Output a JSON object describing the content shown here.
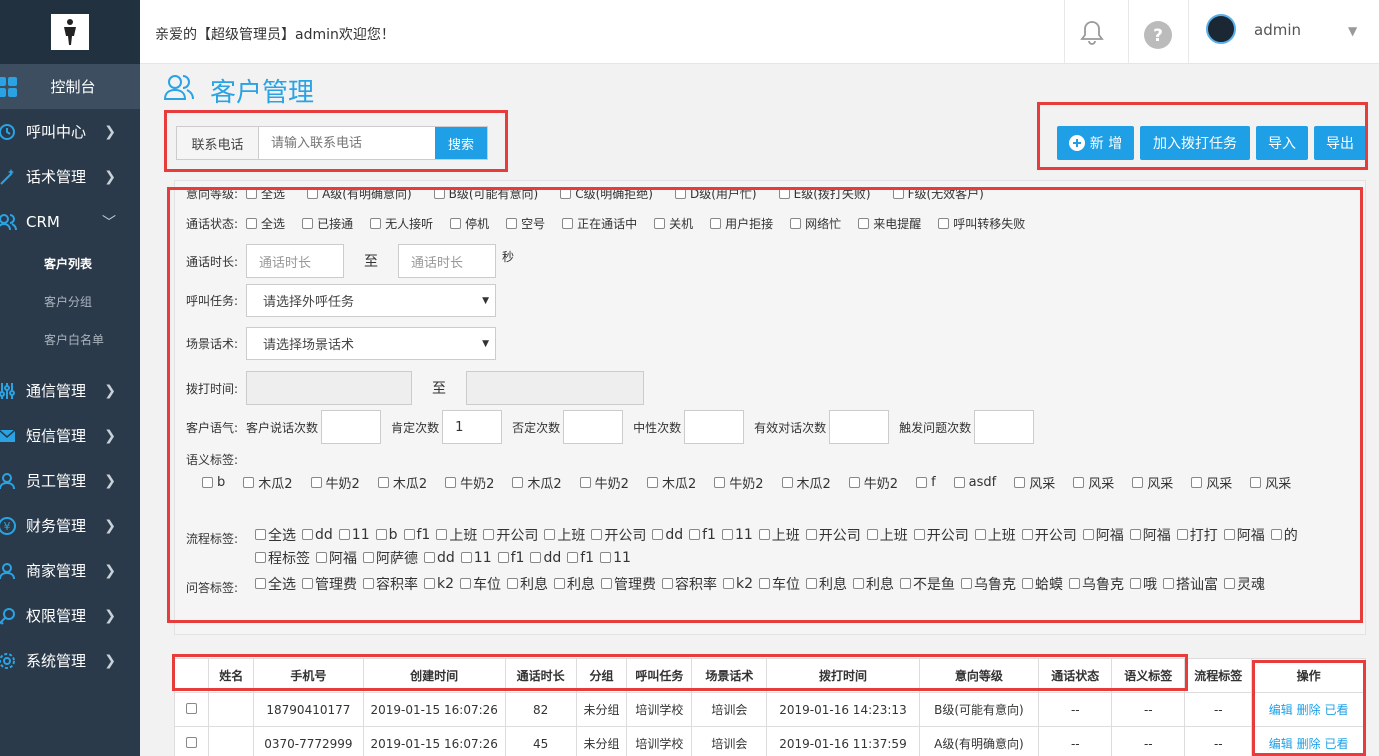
{
  "sidebar": {
    "items": [
      {
        "label": "控制台",
        "icon": "dashboard-icon"
      },
      {
        "label": "呼叫中心",
        "icon": "clock-icon"
      },
      {
        "label": "话术管理",
        "icon": "magic-icon"
      },
      {
        "label": "CRM",
        "icon": "users-icon"
      },
      {
        "label": "通信管理",
        "icon": "sliders-icon"
      },
      {
        "label": "短信管理",
        "icon": "mail-icon"
      },
      {
        "label": "员工管理",
        "icon": "user-icon"
      },
      {
        "label": "财务管理",
        "icon": "yen-icon"
      },
      {
        "label": "商家管理",
        "icon": "user-icon"
      },
      {
        "label": "权限管理",
        "icon": "key-icon"
      },
      {
        "label": "系统管理",
        "icon": "gear-icon"
      }
    ],
    "crm_sub": [
      "客户列表",
      "客户分组",
      "客户白名单"
    ]
  },
  "header": {
    "welcome": "亲爱的【超级管理员】admin欢迎您！",
    "username": "admin"
  },
  "page": {
    "title": "客户管理"
  },
  "search": {
    "label": "联系电话",
    "placeholder": "请输入联系电话",
    "button": "搜索"
  },
  "toolbar": {
    "add": "新 增",
    "add_task": "加入拨打任务",
    "import": "导入",
    "export": "导出"
  },
  "filters": {
    "intent_label": "意向等级:",
    "intent_options": [
      "全选",
      "A级(有明确意向)",
      "B级(可能有意向)",
      "C级(明确拒绝)",
      "D级(用户忙)",
      "E级(拨打失败)",
      "F级(无效客户)"
    ],
    "call_status_label": "通话状态:",
    "call_status_options": [
      "全选",
      "已接通",
      "无人接听",
      "停机",
      "空号",
      "正在通话中",
      "关机",
      "用户拒接",
      "网络忙",
      "来电提醒",
      "呼叫转移失败"
    ],
    "duration_label": "通话时长:",
    "duration_placeholder": "通话时长",
    "to": "至",
    "seconds": "秒",
    "task_label": "呼叫任务:",
    "task_placeholder": "请选择外呼任务",
    "scene_label": "场景话术:",
    "scene_placeholder": "请选择场景话术",
    "dial_time_label": "拨打时间:",
    "tone_label": "客户语气:",
    "tone_fields": [
      {
        "label": "客户说话次数",
        "value": ""
      },
      {
        "label": "肯定次数",
        "value": "1"
      },
      {
        "label": "否定次数",
        "value": ""
      },
      {
        "label": "中性次数",
        "value": ""
      },
      {
        "label": "有效对话次数",
        "value": ""
      },
      {
        "label": "触发问题次数",
        "value": ""
      }
    ],
    "semantic_label": "语义标签:",
    "semantic_tags": [
      "b",
      "木瓜2",
      "牛奶2",
      "木瓜2",
      "牛奶2",
      "木瓜2",
      "牛奶2",
      "木瓜2",
      "牛奶2",
      "木瓜2",
      "牛奶2",
      "f",
      "asdf",
      "风采",
      "风采",
      "风采",
      "风采",
      "风采"
    ],
    "flow_label": "流程标签:",
    "flow_tags": [
      "全选",
      "dd",
      "11",
      "b",
      "f1",
      "上班",
      "开公司",
      "上班",
      "开公司",
      "dd",
      "f1",
      "11",
      "上班",
      "开公司",
      "上班",
      "开公司",
      "上班",
      "开公司",
      "阿福",
      "阿福",
      "打打",
      "阿福",
      "的",
      "程标签",
      "阿福",
      "阿萨德",
      "dd",
      "11",
      "f1",
      "dd",
      "f1",
      "11"
    ],
    "qa_label": "问答标签:",
    "qa_tags": [
      "全选",
      "管理费",
      "容积率",
      "k2",
      "车位",
      "利息",
      "利息",
      "管理费",
      "容积率",
      "k2",
      "车位",
      "利息",
      "利息",
      "不是鱼",
      "乌鲁克",
      "蛤蟆",
      "乌鲁克",
      "哦",
      "搭讪富",
      "灵魂"
    ]
  },
  "table": {
    "headers": [
      "",
      "姓名",
      "手机号",
      "创建时间",
      "通话时长",
      "分组",
      "呼叫任务",
      "场景话术",
      "拨打时间",
      "意向等级",
      "通话状态",
      "语义标签",
      "流程标签",
      "操作"
    ],
    "rows": [
      {
        "name": "",
        "phone": "18790410177",
        "created": "2019-01-15 16:07:26",
        "duration": "82",
        "group": "未分组",
        "task": "培训学校",
        "scene": "培训会",
        "dial_time": "2019-01-16 14:23:13",
        "intent": "B级(可能有意向)",
        "status": "--",
        "semantic": "--",
        "flow": "--",
        "ops": [
          "编辑",
          "删除",
          "已看"
        ]
      },
      {
        "name": "",
        "phone": "0370-7772999",
        "created": "2019-01-15 16:07:26",
        "duration": "45",
        "group": "未分组",
        "task": "培训学校",
        "scene": "培训会",
        "dial_time": "2019-01-16 11:37:59",
        "intent": "A级(有明确意向)",
        "status": "--",
        "semantic": "--",
        "flow": "--",
        "ops": [
          "编辑",
          "删除",
          "已看"
        ]
      }
    ]
  },
  "colors": {
    "accent": "#1e9fe6",
    "highlight": "#e63c3c",
    "sidebar": "#2b3a4a"
  }
}
